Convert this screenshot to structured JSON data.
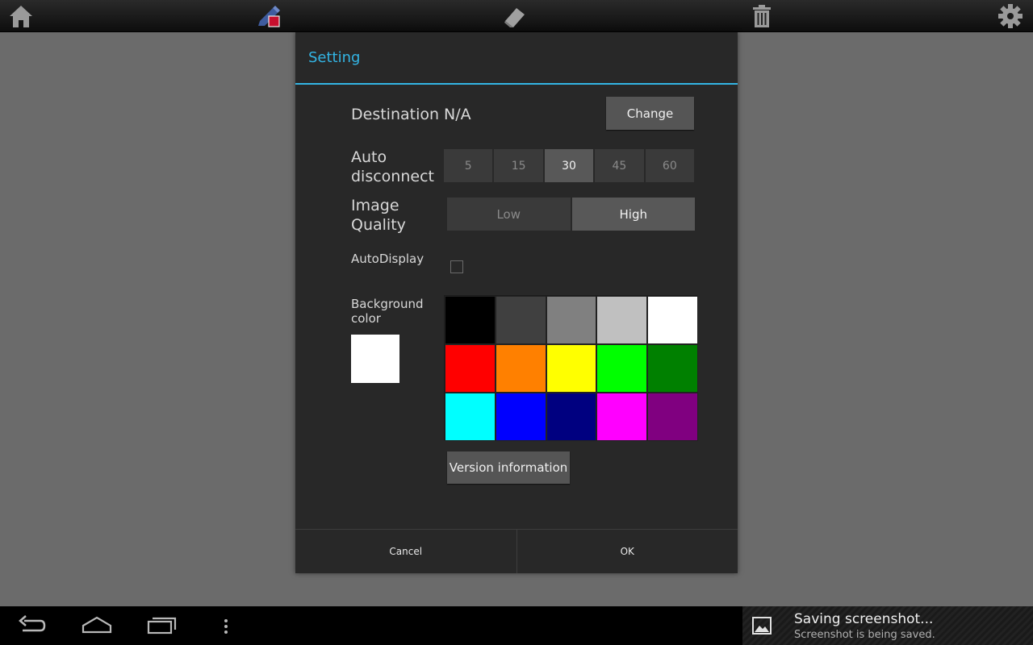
{
  "toolbar": {
    "icons": [
      "home-icon",
      "pen-color-icon",
      "eraser-icon",
      "trash-icon",
      "gear-icon"
    ],
    "pen_color": "#c8102e"
  },
  "dialog": {
    "title": "Setting",
    "accent": "#33b5e5",
    "destination": {
      "label": "Destination",
      "value": "N/A",
      "button": "Change"
    },
    "auto_disconnect": {
      "label_line1": "Auto",
      "label_line2": "disconnect",
      "options": [
        "5",
        "15",
        "30",
        "45",
        "60"
      ],
      "selected": "30"
    },
    "image_quality": {
      "label_line1": "Image",
      "label_line2": "Quality",
      "options": [
        "Low",
        "High"
      ],
      "selected": "High"
    },
    "auto_display": {
      "label": "AutoDisplay",
      "checked": false
    },
    "background_color": {
      "label_line1": "Background",
      "label_line2": "color",
      "current": "#ffffff",
      "palette": [
        "#000000",
        "#404040",
        "#808080",
        "#c0c0c0",
        "#ffffff",
        "#ff0000",
        "#ff8000",
        "#ffff00",
        "#00ff00",
        "#008000",
        "#00ffff",
        "#0000ff",
        "#000080",
        "#ff00ff",
        "#800080"
      ]
    },
    "version_button": "Version information",
    "cancel": "Cancel",
    "ok": "OK"
  },
  "navbar": {
    "icons": [
      "back-icon",
      "home-nav-icon",
      "recent-apps-icon",
      "overflow-menu-icon"
    ]
  },
  "notification": {
    "title": "Saving screenshot...",
    "text": "Screenshot is being saved."
  }
}
